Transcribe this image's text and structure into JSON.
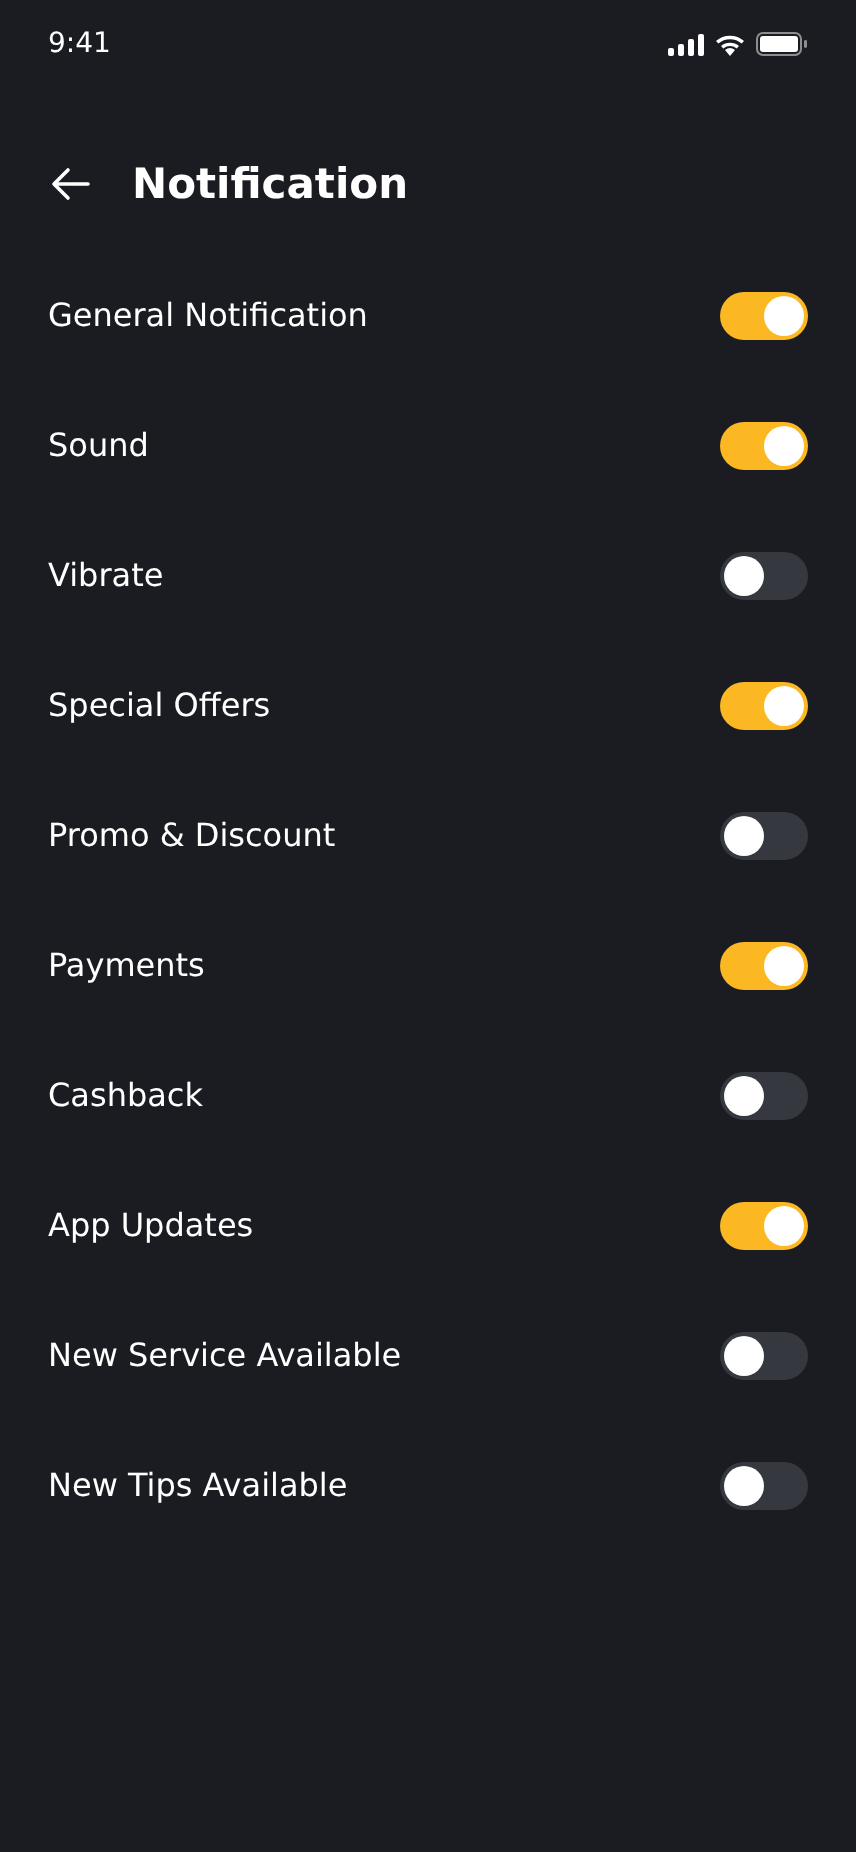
{
  "status_bar": {
    "time": "9:41"
  },
  "header": {
    "title": "Notification"
  },
  "settings": [
    {
      "label": "General Notification",
      "on": true
    },
    {
      "label": "Sound",
      "on": true
    },
    {
      "label": "Vibrate",
      "on": false
    },
    {
      "label": "Special Offers",
      "on": true
    },
    {
      "label": "Promo & Discount",
      "on": false
    },
    {
      "label": "Payments",
      "on": true
    },
    {
      "label": "Cashback",
      "on": false
    },
    {
      "label": "App Updates",
      "on": true
    },
    {
      "label": "New Service Available",
      "on": false
    },
    {
      "label": "New Tips Available",
      "on": false
    }
  ]
}
